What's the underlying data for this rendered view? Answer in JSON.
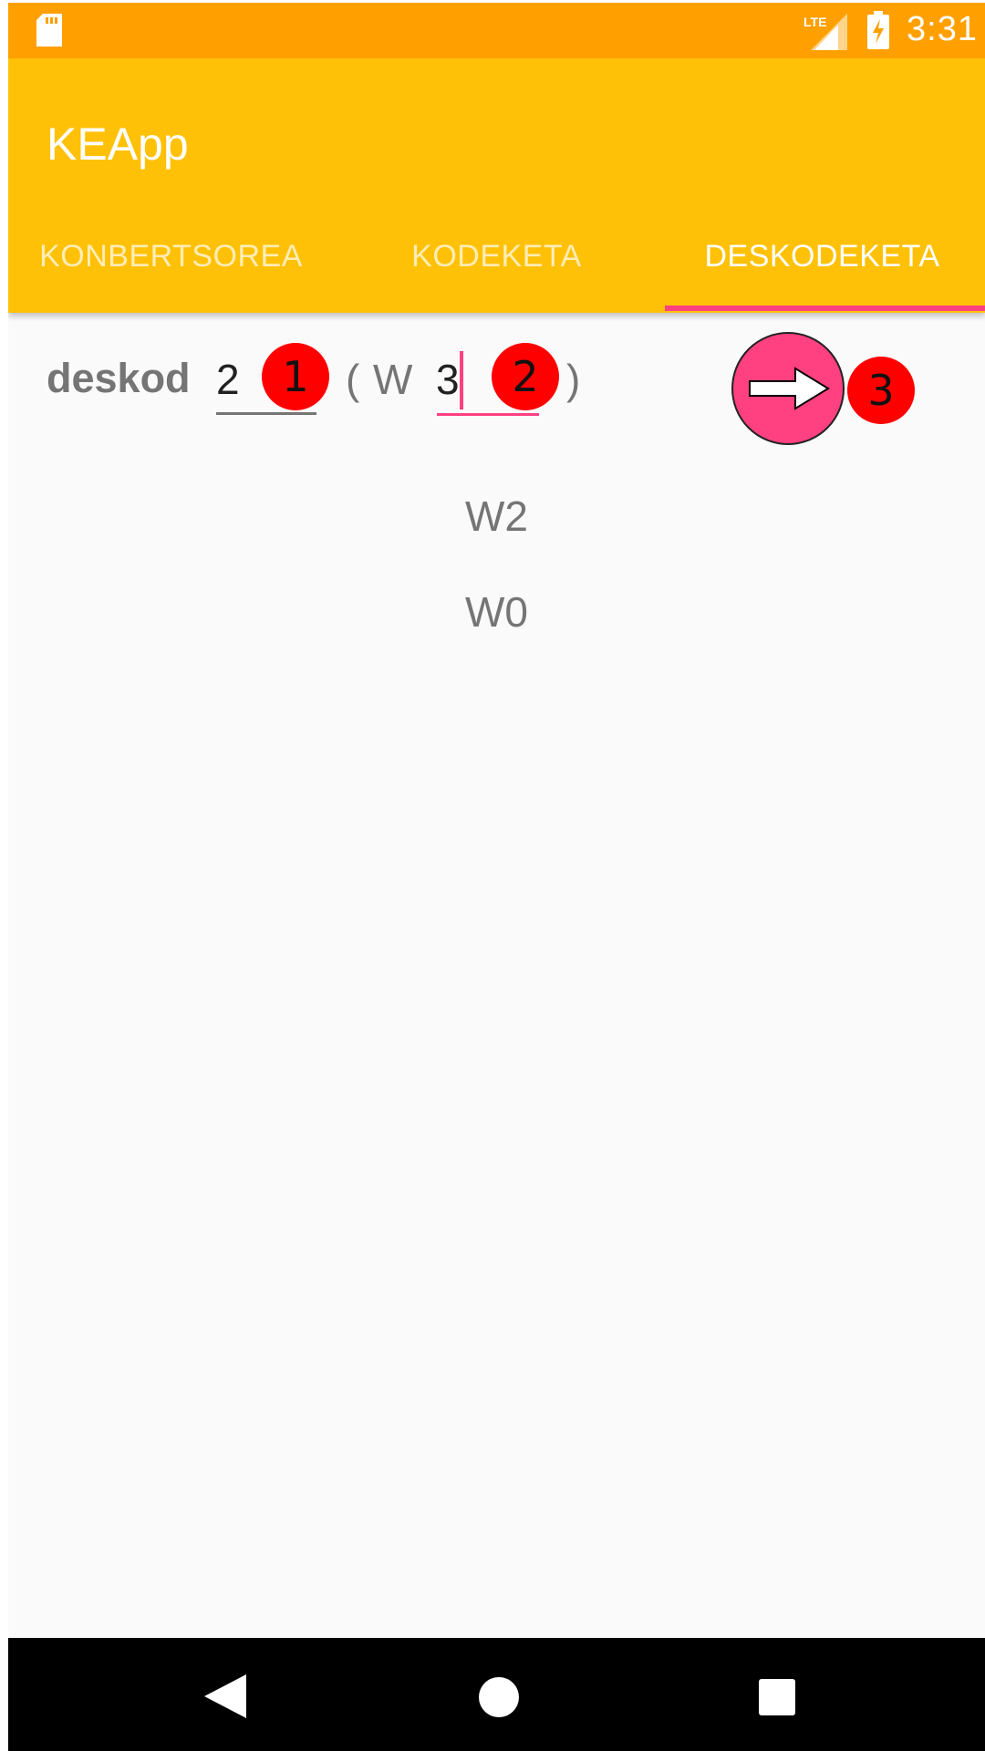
{
  "status_bar": {
    "time": "3:31",
    "network": "LTE",
    "icons": [
      "sd-card-icon",
      "lte-signal-icon",
      "battery-charging-icon"
    ],
    "color": "#ffa000"
  },
  "app_bar": {
    "title": "KEApp",
    "color": "#ffc107"
  },
  "tabs": [
    {
      "label": "KONBERTSOREA",
      "selected": false
    },
    {
      "label": "KODEKETA",
      "selected": false
    },
    {
      "label": "DESKODEKETA",
      "selected": true
    }
  ],
  "decode_form": {
    "label": "deskod",
    "value_field": "2",
    "open_paren": "(",
    "prefix": "W",
    "width_field": "3",
    "close_paren": ")",
    "accent_color": "#ff4081"
  },
  "go_button": {
    "icon": "arrow-right-icon"
  },
  "annotations": [
    "1",
    "2",
    "3"
  ],
  "results": [
    "W2",
    "W0"
  ],
  "nav_bar": {
    "icons": [
      "back-icon",
      "home-icon",
      "recents-icon"
    ]
  }
}
